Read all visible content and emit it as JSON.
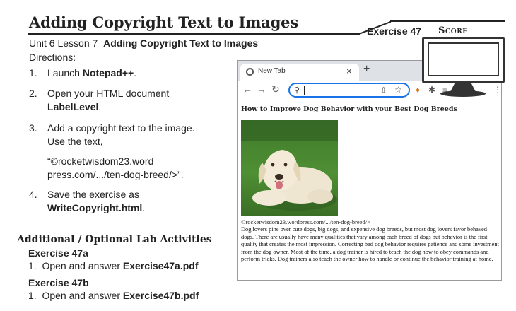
{
  "header": {
    "title": "Adding Copyright Text to Images",
    "exercise": "Exercise 47",
    "score": "Score"
  },
  "subtitle": {
    "prefix": "Unit 6 Lesson 7",
    "bold": "Adding Copyright Text to Images"
  },
  "directions_label": "Directions:",
  "steps": [
    {
      "num": "1.",
      "pre": "Launch ",
      "bold": "Notepad++",
      "post": "."
    },
    {
      "num": "2.",
      "line1": "Open your HTML document",
      "bold": "LabelLevel",
      "post": "."
    },
    {
      "num": "3.",
      "line1": "Add a copyright text to the image.",
      "line2": "Use the text,",
      "line3": "“©rocketwisdom23.word",
      "line4": "press.com/.../ten-dog-breed/>”."
    },
    {
      "num": "4.",
      "line1": "Save the exercise as",
      "bold": "WriteCopyright.html",
      "post": "."
    }
  ],
  "additional": {
    "heading": "Additional / Optional Lab Activities",
    "items": [
      {
        "title": "Exercise 47a",
        "num": "1.",
        "text": "Open and answer ",
        "file": "Exercise47a.pdf"
      },
      {
        "title": "Exercise 47b",
        "num": "1.",
        "text": "Open and answer ",
        "file": "Exercise47b.pdf"
      }
    ]
  },
  "browser": {
    "tab_title": "New Tab",
    "tab_close": "×",
    "new_tab": "+",
    "icons": [
      "back-icon",
      "forward-icon",
      "reload-icon",
      "search-icon",
      "share-icon",
      "star-icon",
      "fox-extension-icon",
      "puzzle-icon",
      "menu-icon"
    ]
  },
  "page": {
    "heading": "How to Improve Dog Behavior with your Best Dog Breeds",
    "caption": "©rocketwisdom23.wordpress.com/.../ten-dog-breed/>",
    "paragraph": "Dog lovers pine over cute dogs, big dogs, and expensive dog breeds, but most dog lovers favor behaved dogs. There are usually have many qualities that vary among each breed of dogs but behavior is the first quality that creates the most impression. Correcting bad dog behavior requires patience and some investment from the dog owner. Most of the time, a dog trainer is hired to teach the dog how to obey commands and perform tricks. Dog trainers also teach the owner how to handle or continue the behavior training at home."
  },
  "colors": {
    "accent": "#1a73e8",
    "tabstrip": "#dee1e6",
    "ink": "#222222"
  }
}
